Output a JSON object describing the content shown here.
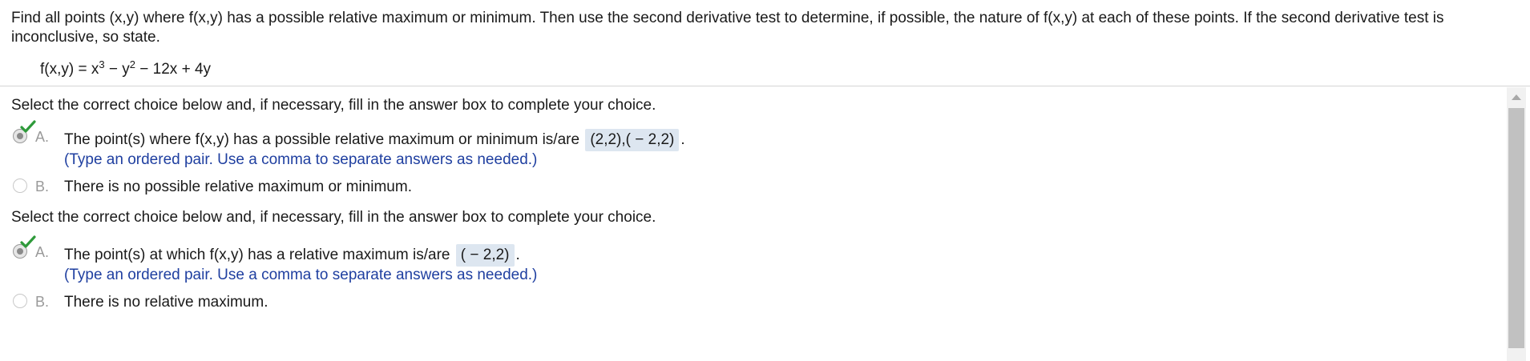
{
  "question": {
    "text": "Find all points (x,y) where f(x,y) has a possible relative maximum or minimum.  Then use the second derivative test to determine, if possible, the nature of f(x,y) at each of these points.  If the second derivative test is inconclusive, so state.",
    "formula": {
      "lhs": "f(x,y) = x",
      "exp1": "3",
      "mid": " − y",
      "exp2": "2",
      "rhs": " − 12x + 4y"
    }
  },
  "parts": [
    {
      "prompt": "Select the correct choice below and, if necessary, fill in the answer box to complete your choice.",
      "choice_a": {
        "letter": "A.",
        "text_before": "The point(s) where f(x,y) has a possible relative maximum or minimum is/are",
        "answer": "(2,2),( − 2,2)",
        "text_after": ".",
        "hint": "(Type an ordered pair. Use a comma to separate answers as needed.)"
      },
      "choice_b": {
        "letter": "B.",
        "text": "There is no possible relative maximum or minimum."
      }
    },
    {
      "prompt": "Select the correct choice below and, if necessary, fill in the answer box to complete your choice.",
      "choice_a": {
        "letter": "A.",
        "text_before": "The point(s) at which f(x,y) has a relative maximum is/are",
        "answer": "( − 2,2)",
        "text_after": ".",
        "hint": "(Type an ordered pair. Use a comma to separate answers as needed.)"
      },
      "choice_b": {
        "letter": "B.",
        "text": "There is no relative maximum."
      }
    }
  ],
  "colors": {
    "hint_text": "#1f3fa0",
    "answer_box": "#dde6f0",
    "check_mark": "#2e9a3a"
  }
}
